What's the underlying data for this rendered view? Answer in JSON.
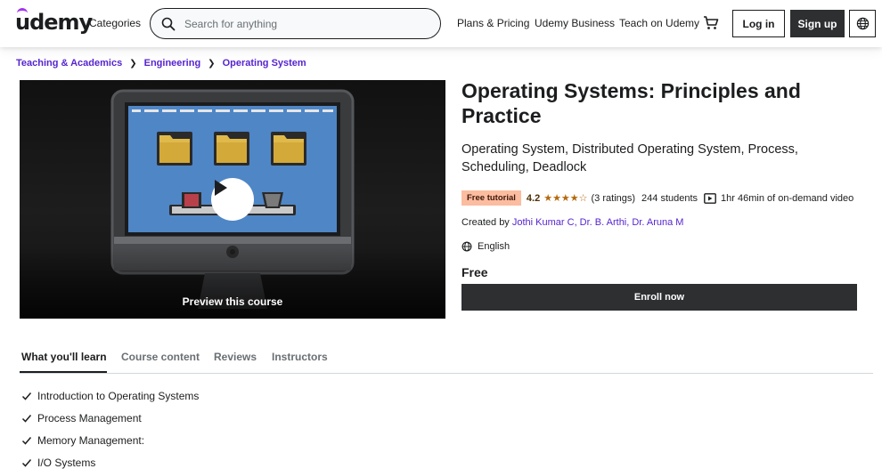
{
  "header": {
    "logo_text": "udemy",
    "categories_label": "Categories",
    "search_placeholder": "Search for anything",
    "plans_label": "Plans & Pricing",
    "business_label": "Udemy Business",
    "teach_label": "Teach on Udemy",
    "login_label": "Log in",
    "signup_label": "Sign up",
    "icons": {
      "search": "search-icon",
      "cart": "cart-icon",
      "language": "globe-icon"
    }
  },
  "breadcrumb": {
    "items": [
      "Teaching & Academics",
      "Engineering",
      "Operating System"
    ]
  },
  "preview": {
    "label": "Preview this course",
    "icon": "play-icon"
  },
  "course": {
    "title": "Operating Systems: Principles and Practice",
    "subtitle": "Operating System, Distributed Operating System, Process, Scheduling, Deadlock",
    "badge": "Free tutorial",
    "rating": "4.2",
    "stars": "★★★★☆",
    "rating_count": "(3 ratings)",
    "students": "244 students",
    "video_length": "1hr 46min of on-demand video",
    "created_by_label": "Created by",
    "instructors": "Jothi Kumar C, Dr. B. Arthi, Dr. Aruna M",
    "language": "English",
    "price": "Free",
    "enroll_label": "Enroll now"
  },
  "tabs": [
    {
      "label": "What you'll learn",
      "active": true
    },
    {
      "label": "Course content",
      "active": false
    },
    {
      "label": "Reviews",
      "active": false
    },
    {
      "label": "Instructors",
      "active": false
    }
  ],
  "learn_items": [
    "Introduction to Operating Systems",
    "Process Management",
    "Memory Management:",
    "I/O Systems"
  ],
  "colors": {
    "brand_purple": "#a435f0",
    "link_purple": "#5624d0",
    "dark_button": "#2d2f31",
    "badge_bg": "#fcbca0",
    "star": "#b4690e"
  }
}
